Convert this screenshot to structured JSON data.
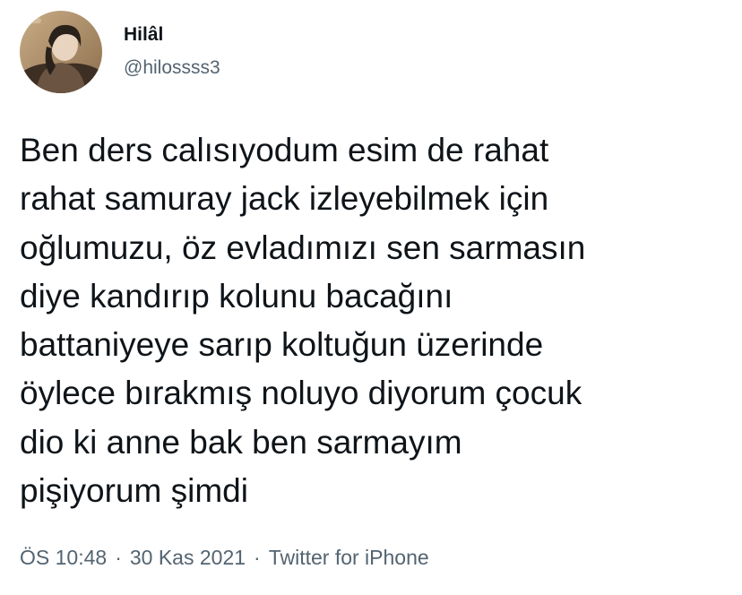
{
  "user": {
    "display_name": "Hilâl",
    "handle": "@hilossss3",
    "avatar_icon": "profile-photo"
  },
  "tweet": {
    "lines": [
      "Ben ders calısıyodum esim de rahat",
      "rahat samuray jack izleyebilmek için",
      "oğlumuzu, öz evladımızı sen sarmasın",
      "diye kandırıp kolunu bacağını",
      "battaniyeye sarıp koltuğun üzerinde",
      "öylece bırakmış noluyo diyorum çocuk",
      "dio ki anne bak ben sarmayım",
      "pişiyorum şimdi"
    ]
  },
  "meta": {
    "time": "ÖS 10:48",
    "separator": "·",
    "date": "30 Kas 2021",
    "source": "Twitter for iPhone"
  },
  "colors": {
    "text": "#0f1419",
    "secondary": "#536471",
    "background": "#ffffff"
  }
}
